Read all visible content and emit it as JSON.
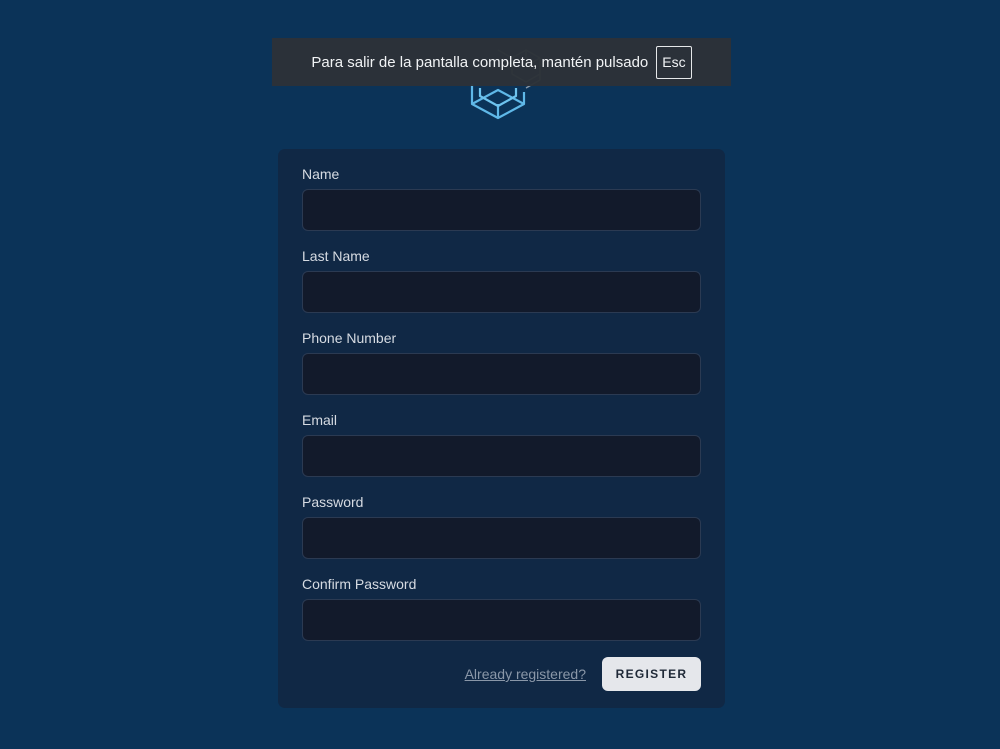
{
  "fullscreen_notice": {
    "message": "Para salir de la pantalla completa, mantén pulsado",
    "key_label": "Esc"
  },
  "logo": {
    "icon": "laravel-cube-logo",
    "stroke_color": "#5fb8e8"
  },
  "form": {
    "fields": [
      {
        "label": "Name",
        "value": ""
      },
      {
        "label": "Last Name",
        "value": ""
      },
      {
        "label": "Phone Number",
        "value": ""
      },
      {
        "label": "Email",
        "value": ""
      },
      {
        "label": "Password",
        "value": ""
      },
      {
        "label": "Confirm Password",
        "value": ""
      }
    ],
    "already_registered_link": "Already registered?",
    "register_button": "REGISTER"
  },
  "colors": {
    "page_background": "#0b3358",
    "card_background": "#102845",
    "input_background": "#121a2b",
    "button_background": "#e5e7eb"
  }
}
